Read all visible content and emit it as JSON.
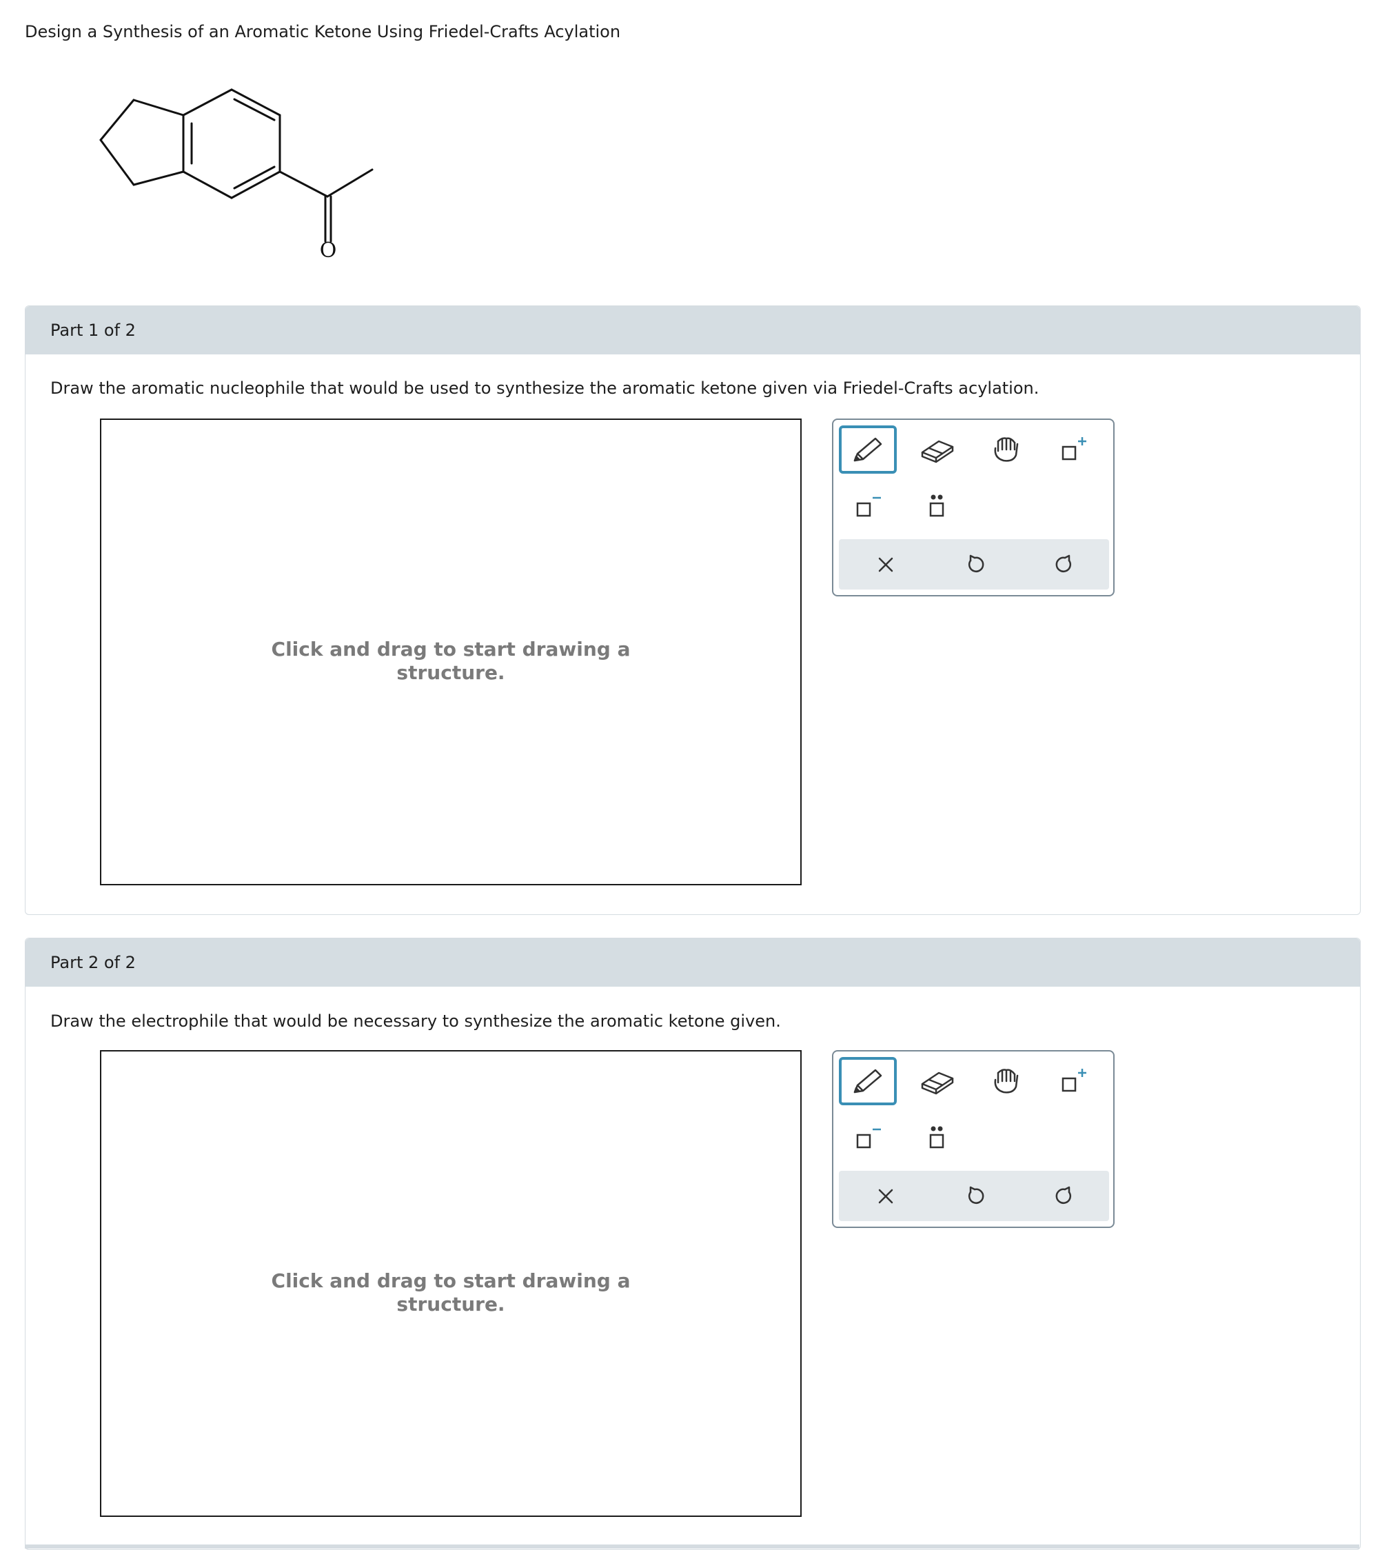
{
  "page": {
    "title": "Design a Synthesis of an Aromatic Ketone Using Friedel-Crafts Acylation"
  },
  "molecule": {
    "atom_label_oxygen": "O"
  },
  "parts": [
    {
      "header": "Part 1 of 2",
      "instruction": "Draw the aromatic nucleophile that would be used to synthesize the aromatic ketone given via Friedel-Crafts acylation.",
      "canvas_hint_line1": "Click and drag to start drawing a",
      "canvas_hint_line2": "structure."
    },
    {
      "header": "Part 2 of 2",
      "instruction": "Draw the electrophile that would be necessary to synthesize the aromatic ketone given.",
      "canvas_hint_line1": "Click and drag to start drawing a",
      "canvas_hint_line2": "structure."
    }
  ],
  "toolbar": {
    "tools": [
      "pencil-icon",
      "eraser-icon",
      "hand-icon",
      "positive-charge-icon",
      "negative-charge-icon",
      "lone-pair-icon"
    ],
    "actions": [
      "clear-icon",
      "undo-icon",
      "redo-icon"
    ],
    "active_tool": "pencil-icon",
    "colors": {
      "accent": "#3a8fb5",
      "charge_sign": "#3a8fb5",
      "icon": "#333333",
      "action_bar_bg": "#e4e9ec",
      "header_bg": "#d5dde2"
    }
  }
}
